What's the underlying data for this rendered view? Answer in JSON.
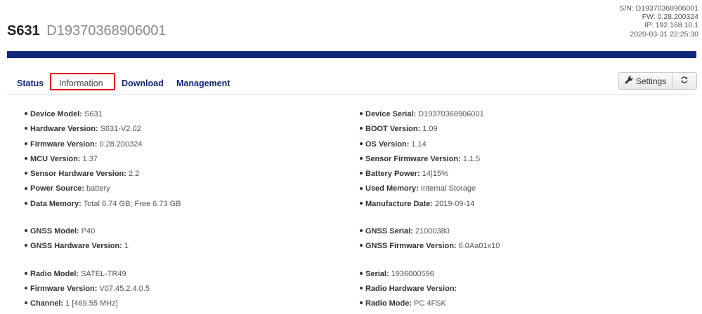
{
  "header": {
    "model": "S631",
    "serial": "D19370368906001",
    "meta": {
      "sn": "S/N: D19370368906001",
      "fw": "FW: 0.28.200324",
      "ip": "IP: 192.168.10.1",
      "datetime": "2020-03-31 22:25:30"
    },
    "accent_color": "#12287a"
  },
  "tabs": [
    {
      "label": "Status"
    },
    {
      "label": "Information",
      "active": true
    },
    {
      "label": "Download"
    },
    {
      "label": "Management"
    }
  ],
  "toolbar": {
    "settings_label": "Settings",
    "settings_icon": "wrench-icon",
    "refresh_icon": "refresh-icon"
  },
  "info": {
    "left": [
      [
        {
          "label": "Device Model:",
          "value": "S631"
        },
        {
          "label": "Hardware Version:",
          "value": "S631-V2.02"
        },
        {
          "label": "Firmware Version:",
          "value": "0.28.200324"
        },
        {
          "label": "MCU Version:",
          "value": "1.37"
        },
        {
          "label": "Sensor Hardware Version:",
          "value": "2.2"
        },
        {
          "label": "Power Source:",
          "value": "battery"
        },
        {
          "label": "Data Memory:",
          "value": "Total 6.74 GB;  Free 6.73 GB"
        }
      ],
      [
        {
          "label": "GNSS Model:",
          "value": "P40"
        },
        {
          "label": "GNSS Hardware Version:",
          "value": "1"
        }
      ],
      [
        {
          "label": "Radio Model:",
          "value": "SATEL-TR49"
        },
        {
          "label": "Firmware Version:",
          "value": "V07.45.2.4.0.5"
        },
        {
          "label": "Channel:",
          "value": "1 [469.55 MHz]"
        }
      ]
    ],
    "right": [
      [
        {
          "label": "Device Serial:",
          "value": "D19370368906001"
        },
        {
          "label": "BOOT Version:",
          "value": "1.09"
        },
        {
          "label": "OS Version:",
          "value": "1.14"
        },
        {
          "label": "Sensor Firmware Version:",
          "value": "1.1.5"
        },
        {
          "label": "Battery Power:",
          "value": "14|15%"
        },
        {
          "label": "Used Memory:",
          "value": "Internal Storage"
        },
        {
          "label": "Manufacture Date:",
          "value": "2019-09-14"
        }
      ],
      [
        {
          "label": "GNSS Serial:",
          "value": "21000380"
        },
        {
          "label": "GNSS Firmware Version:",
          "value": "6.0Aa01x10"
        }
      ],
      [
        {
          "label": "Serial:",
          "value": "1936000596"
        },
        {
          "label": "Radio Hardware Version:",
          "value": ""
        },
        {
          "label": "Radio Mode:",
          "value": "PC 4FSK"
        }
      ]
    ]
  }
}
